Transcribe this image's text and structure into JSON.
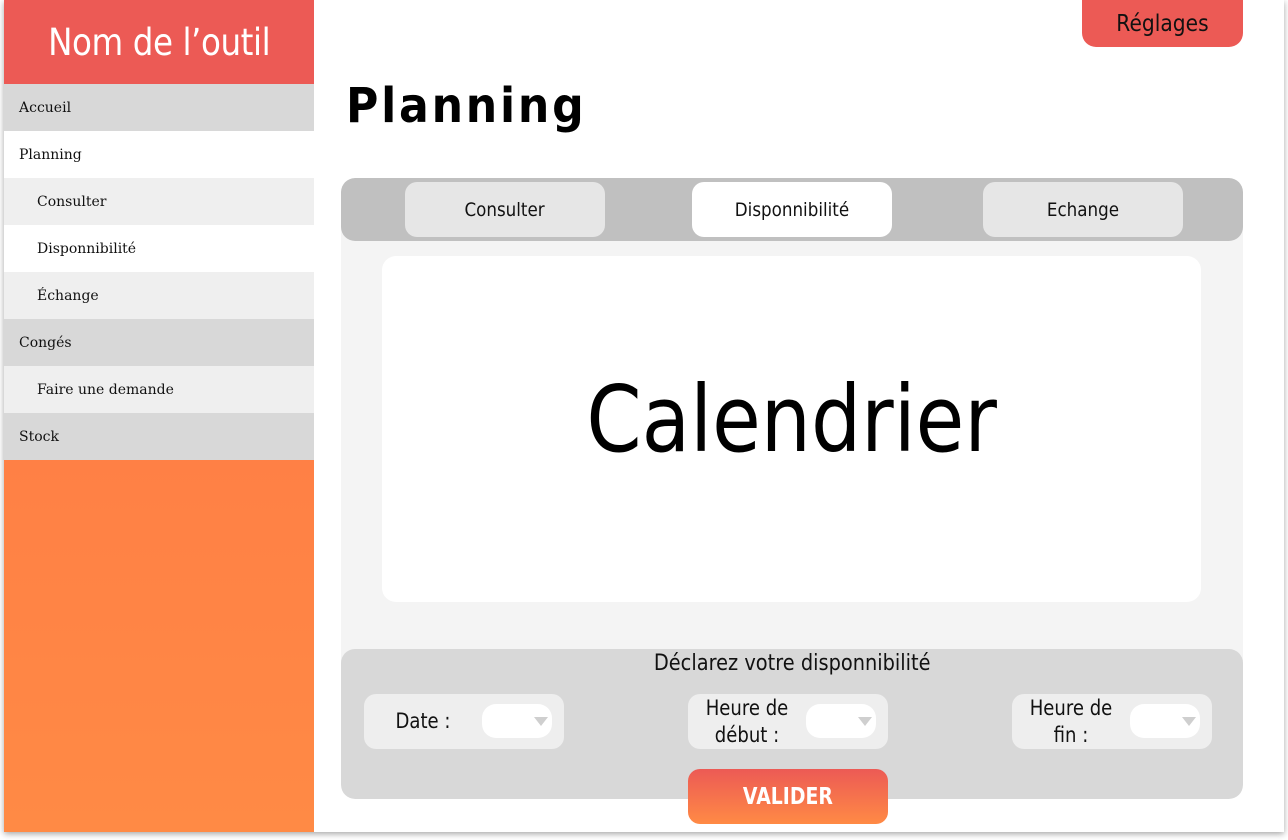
{
  "app": {
    "title": "Nom de l’outil",
    "settings_label": "Réglages"
  },
  "sidebar": {
    "items": [
      {
        "label": "Accueil",
        "level": 0
      },
      {
        "label": "Planning",
        "level": 0,
        "active": true
      },
      {
        "label": "Consulter",
        "level": 1
      },
      {
        "label": "Disponnibilité",
        "level": 1
      },
      {
        "label": "Échange",
        "level": 1
      },
      {
        "label": "Congés",
        "level": 0
      },
      {
        "label": "Faire une demande",
        "level": 1
      },
      {
        "label": "Stock",
        "level": 0
      }
    ]
  },
  "main": {
    "title": "Planning",
    "tabs": [
      {
        "label": "Consulter",
        "active": false
      },
      {
        "label": "Disponnibilité",
        "active": true
      },
      {
        "label": "Echange",
        "active": false
      }
    ],
    "calendar_label": "Calendrier",
    "form": {
      "title": "Déclarez votre disponnibilité",
      "fields": [
        {
          "label": "Date :",
          "value": ""
        },
        {
          "label": "Heure de début :",
          "value": ""
        },
        {
          "label": "Heure de fin :",
          "value": ""
        }
      ],
      "submit_label": "VALIDER"
    }
  },
  "colors": {
    "accent": "#ec5a55",
    "gradient_end": "#ff8a45",
    "tabbar": "#c0c0c0",
    "panel": "#f4f4f4"
  }
}
